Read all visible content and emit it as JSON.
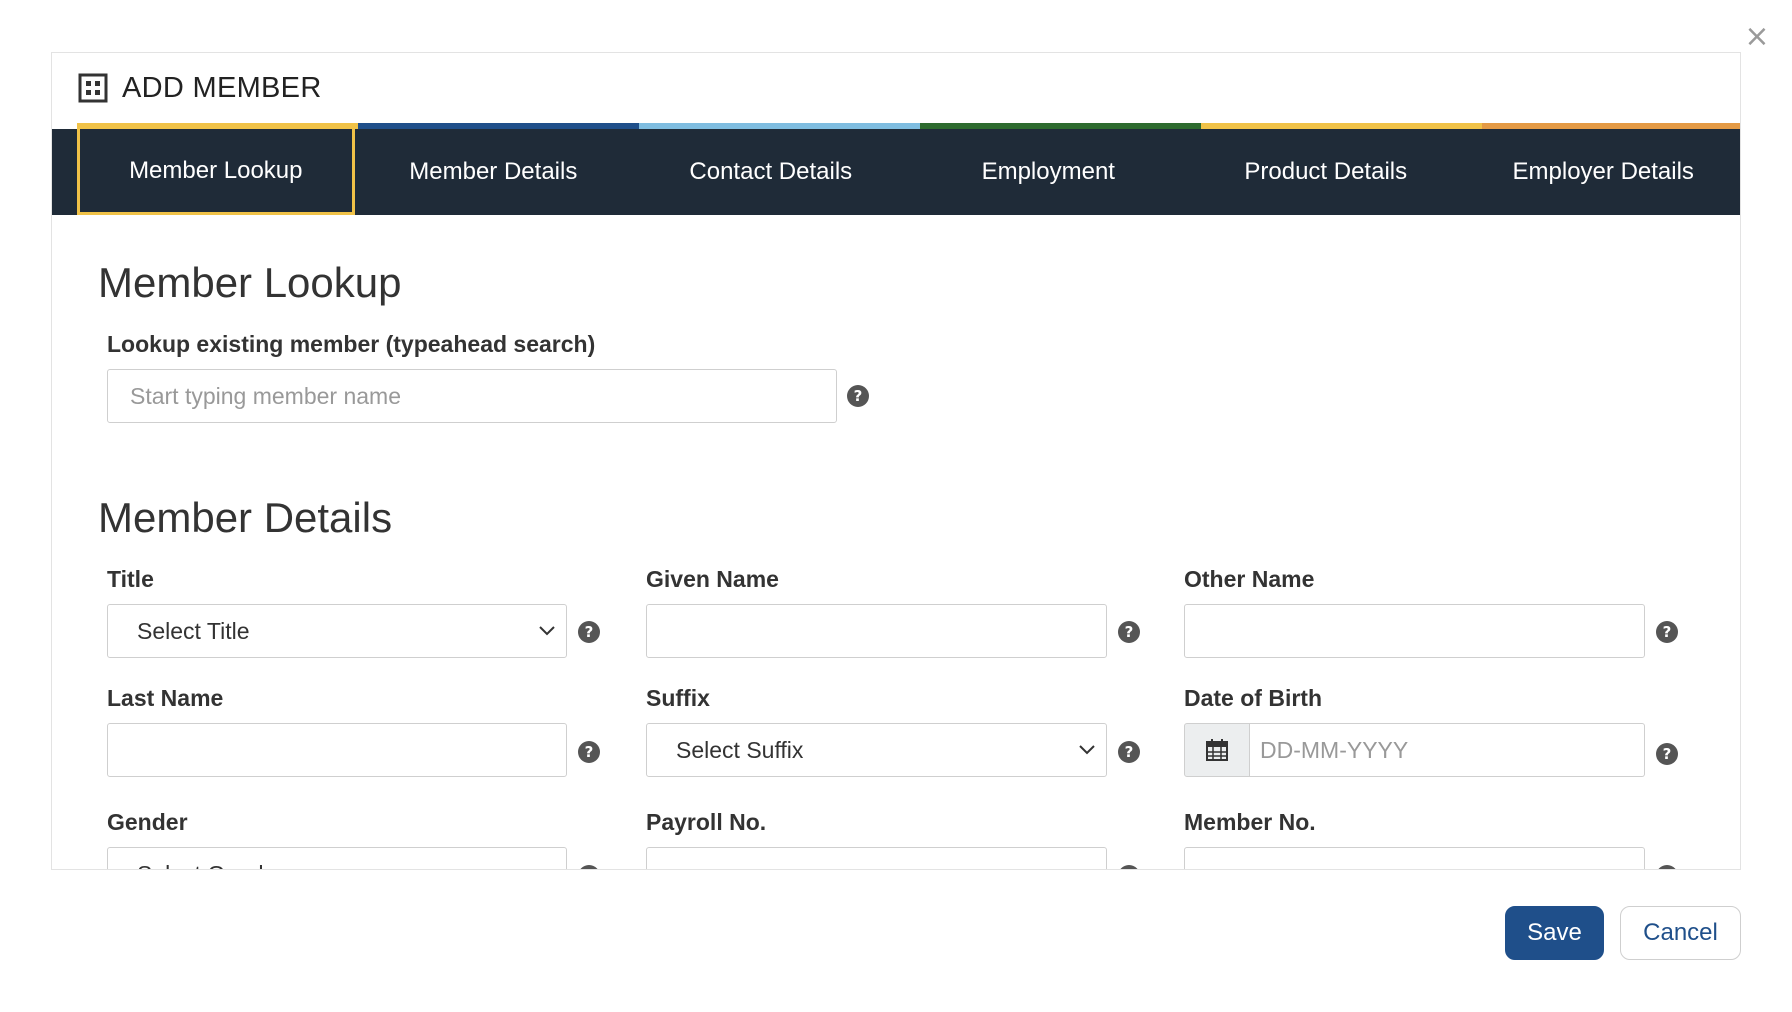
{
  "modal": {
    "close_glyph": "×",
    "title": "ADD MEMBER",
    "title_icon": "grid-icon"
  },
  "tabs": [
    {
      "label": "Member Lookup",
      "stripe_color": "#f0c248",
      "active": true
    },
    {
      "label": "Member Details",
      "stripe_color": "#1f4f8a",
      "active": false
    },
    {
      "label": "Contact Details",
      "stripe_color": "#7fbde0",
      "active": false
    },
    {
      "label": "Employment",
      "stripe_color": "#2e6b2f",
      "active": false
    },
    {
      "label": "Product Details",
      "stripe_color": "#f0c248",
      "active": false
    },
    {
      "label": "Employer Details",
      "stripe_color": "#e49a45",
      "active": false
    }
  ],
  "member_lookup": {
    "heading": "Member Lookup",
    "label": "Lookup existing member (typeahead search)",
    "placeholder": "Start typing member name"
  },
  "member_details": {
    "heading": "Member Details",
    "title": {
      "label": "Title",
      "value": "Select Title"
    },
    "given_name": {
      "label": "Given Name",
      "value": ""
    },
    "other_name": {
      "label": "Other Name",
      "value": ""
    },
    "last_name": {
      "label": "Last Name",
      "value": ""
    },
    "suffix": {
      "label": "Suffix",
      "value": "Select Suffix"
    },
    "dob": {
      "label": "Date of Birth",
      "placeholder": "DD-MM-YYYY"
    },
    "gender": {
      "label": "Gender",
      "value": "Select Gender"
    },
    "payroll_no": {
      "label": "Payroll No.",
      "value": ""
    },
    "member_no": {
      "label": "Member No.",
      "value": ""
    }
  },
  "help_glyph": "?",
  "footer": {
    "save_label": "Save",
    "cancel_label": "Cancel"
  },
  "colors": {
    "tab_bar_bg": "#1f2b38",
    "primary": "#1f4f8a",
    "active_tab_border": "#f0c248"
  }
}
